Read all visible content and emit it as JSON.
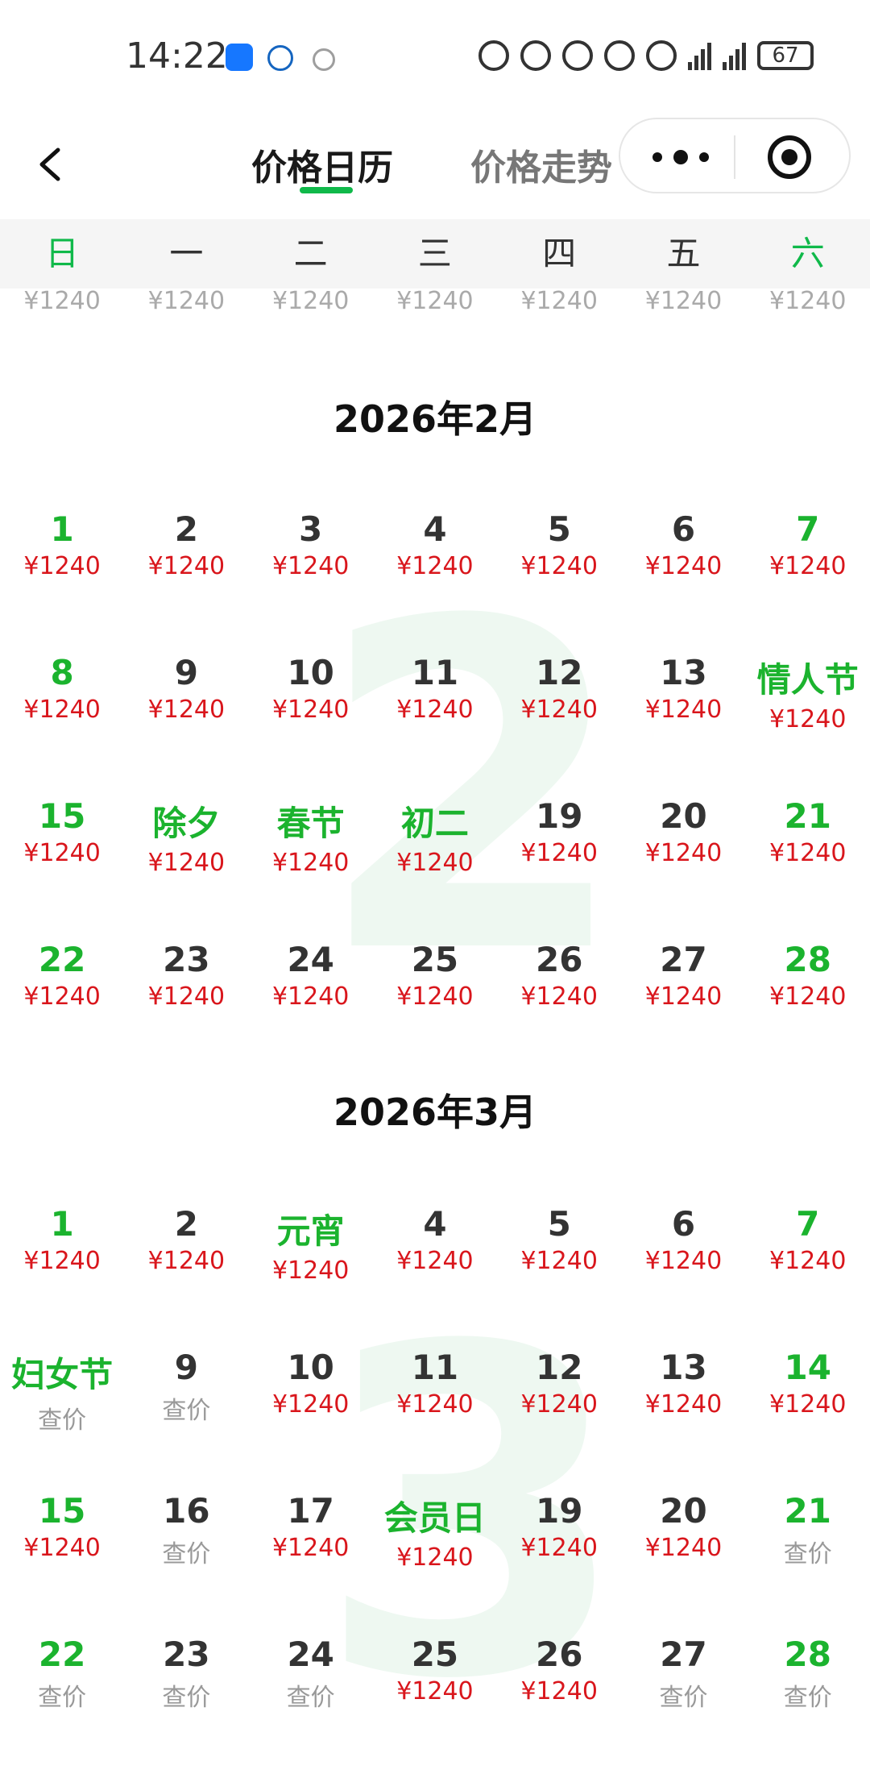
{
  "status_bar": {
    "time": "14:22",
    "battery": "67"
  },
  "nav": {
    "tab_active": "价格日历",
    "tab_inactive": "价格走势"
  },
  "weekdays": [
    "日",
    "一",
    "二",
    "三",
    "四",
    "五",
    "六"
  ],
  "prev_month_prices": [
    "¥1240",
    "¥1240",
    "¥1240",
    "¥1240",
    "¥1240",
    "¥1240",
    "¥1240"
  ],
  "months": [
    {
      "title": "2026年2月",
      "watermark": "2",
      "weeks": [
        [
          {
            "label": "1",
            "green": true,
            "price": "¥1240"
          },
          {
            "label": "2",
            "price": "¥1240"
          },
          {
            "label": "3",
            "price": "¥1240"
          },
          {
            "label": "4",
            "price": "¥1240"
          },
          {
            "label": "5",
            "price": "¥1240"
          },
          {
            "label": "6",
            "price": "¥1240"
          },
          {
            "label": "7",
            "green": true,
            "price": "¥1240"
          }
        ],
        [
          {
            "label": "8",
            "green": true,
            "price": "¥1240"
          },
          {
            "label": "9",
            "price": "¥1240"
          },
          {
            "label": "10",
            "price": "¥1240"
          },
          {
            "label": "11",
            "price": "¥1240"
          },
          {
            "label": "12",
            "price": "¥1240"
          },
          {
            "label": "13",
            "price": "¥1240"
          },
          {
            "label": "情人节",
            "green": true,
            "price": "¥1240"
          }
        ],
        [
          {
            "label": "15",
            "green": true,
            "price": "¥1240"
          },
          {
            "label": "除夕",
            "green": true,
            "price": "¥1240"
          },
          {
            "label": "春节",
            "green": true,
            "price": "¥1240"
          },
          {
            "label": "初二",
            "green": true,
            "price": "¥1240"
          },
          {
            "label": "19",
            "price": "¥1240"
          },
          {
            "label": "20",
            "price": "¥1240"
          },
          {
            "label": "21",
            "green": true,
            "price": "¥1240"
          }
        ],
        [
          {
            "label": "22",
            "green": true,
            "price": "¥1240"
          },
          {
            "label": "23",
            "price": "¥1240"
          },
          {
            "label": "24",
            "price": "¥1240"
          },
          {
            "label": "25",
            "price": "¥1240"
          },
          {
            "label": "26",
            "price": "¥1240"
          },
          {
            "label": "27",
            "price": "¥1240"
          },
          {
            "label": "28",
            "green": true,
            "price": "¥1240"
          }
        ]
      ]
    },
    {
      "title": "2026年3月",
      "watermark": "3",
      "weeks": [
        [
          {
            "label": "1",
            "green": true,
            "price": "¥1240"
          },
          {
            "label": "2",
            "price": "¥1240"
          },
          {
            "label": "元宵",
            "green": true,
            "price": "¥1240"
          },
          {
            "label": "4",
            "price": "¥1240"
          },
          {
            "label": "5",
            "price": "¥1240"
          },
          {
            "label": "6",
            "price": "¥1240"
          },
          {
            "label": "7",
            "green": true,
            "price": "¥1240"
          }
        ],
        [
          {
            "label": "妇女节",
            "green": true,
            "price": "查价",
            "gray": true
          },
          {
            "label": "9",
            "price": "查价",
            "gray": true
          },
          {
            "label": "10",
            "price": "¥1240"
          },
          {
            "label": "11",
            "price": "¥1240"
          },
          {
            "label": "12",
            "price": "¥1240"
          },
          {
            "label": "13",
            "price": "¥1240"
          },
          {
            "label": "14",
            "green": true,
            "price": "¥1240"
          }
        ],
        [
          {
            "label": "15",
            "green": true,
            "price": "¥1240"
          },
          {
            "label": "16",
            "price": "查价",
            "gray": true
          },
          {
            "label": "17",
            "price": "¥1240"
          },
          {
            "label": "会员日",
            "green": true,
            "price": "¥1240"
          },
          {
            "label": "19",
            "price": "¥1240"
          },
          {
            "label": "20",
            "price": "¥1240"
          },
          {
            "label": "21",
            "green": true,
            "price": "查价",
            "gray": true
          }
        ],
        [
          {
            "label": "22",
            "green": true,
            "price": "查价",
            "gray": true
          },
          {
            "label": "23",
            "price": "查价",
            "gray": true
          },
          {
            "label": "24",
            "price": "查价",
            "gray": true
          },
          {
            "label": "25",
            "price": "¥1240"
          },
          {
            "label": "26",
            "price": "¥1240"
          },
          {
            "label": "27",
            "price": "查价",
            "gray": true
          },
          {
            "label": "28",
            "green": true,
            "price": "查价",
            "gray": true
          }
        ]
      ]
    }
  ]
}
